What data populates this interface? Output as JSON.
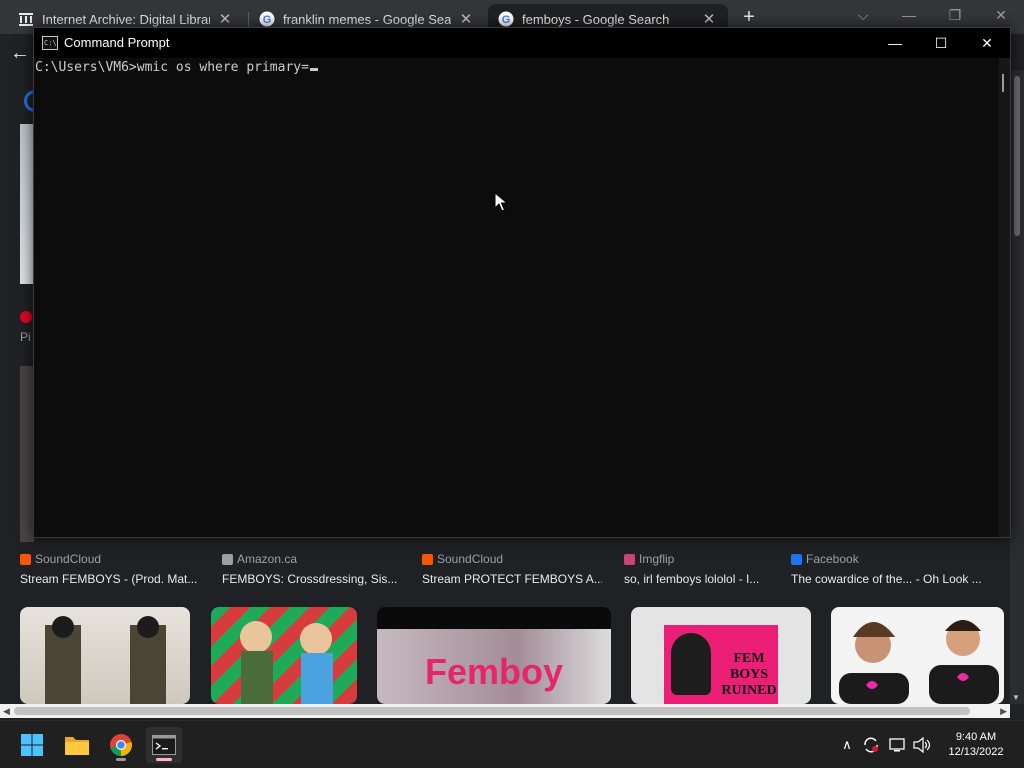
{
  "browser": {
    "tabs": [
      {
        "title": "Internet Archive: Digital Library o",
        "favicon": "archive-icon"
      },
      {
        "title": "franklin memes - Google Search",
        "favicon": "google-icon"
      },
      {
        "title": "femboys - Google Search",
        "favicon": "google-icon",
        "active": true
      }
    ],
    "new_tab": "+",
    "tab_close": "✕",
    "window_controls": {
      "tabsearch": "⌵",
      "minimize": "—",
      "maximize": "❐",
      "close": "✕"
    },
    "back": "←"
  },
  "page": {
    "pinterest_text": "Pi",
    "results": [
      {
        "source": "SoundCloud",
        "caption": "Stream FEMBOYS - (Prod. Mat...",
        "source_color": "#ff5500"
      },
      {
        "source": "Amazon.ca",
        "caption": "FEMBOYS: Crossdressing, Sis...",
        "source_color": "#9aa0a6"
      },
      {
        "source": "SoundCloud",
        "caption": "Stream PROTECT FEMBOYS A...",
        "source_color": "#ff5500"
      },
      {
        "source": "Imgflip",
        "caption": "so, irl femboys lololol - I...",
        "source_color": "#c6486e"
      },
      {
        "source": "Facebook",
        "caption": "The cowardice of the... - Oh Look ...",
        "source_color": "#1877f2"
      }
    ],
    "image_texts": {
      "femboy_banner": "Femboy",
      "fem_boys_ruined": "FEM BOYS RUINED"
    }
  },
  "cmd": {
    "title": "Command Prompt",
    "icon_text": "C:\\",
    "controls": {
      "minimize": "—",
      "maximize": "☐",
      "close": "✕"
    },
    "prompt": "C:\\Users\\VM6>",
    "command": "wmic os where primary="
  },
  "taskbar": {
    "apps": [
      "start-icon",
      "file-explorer-icon",
      "chrome-icon",
      "command-prompt-icon"
    ],
    "tray": {
      "chevron": "∧",
      "time": "9:40 AM",
      "date": "12/13/2022"
    }
  },
  "colors": {
    "chrome_tabstrip": "#35363a",
    "page_bg": "#202124",
    "cmd_bg": "#0c0c0c",
    "cmd_text": "#cccccc",
    "taskbar_bg": "#202020",
    "accent_blue": "#1a73e8"
  }
}
